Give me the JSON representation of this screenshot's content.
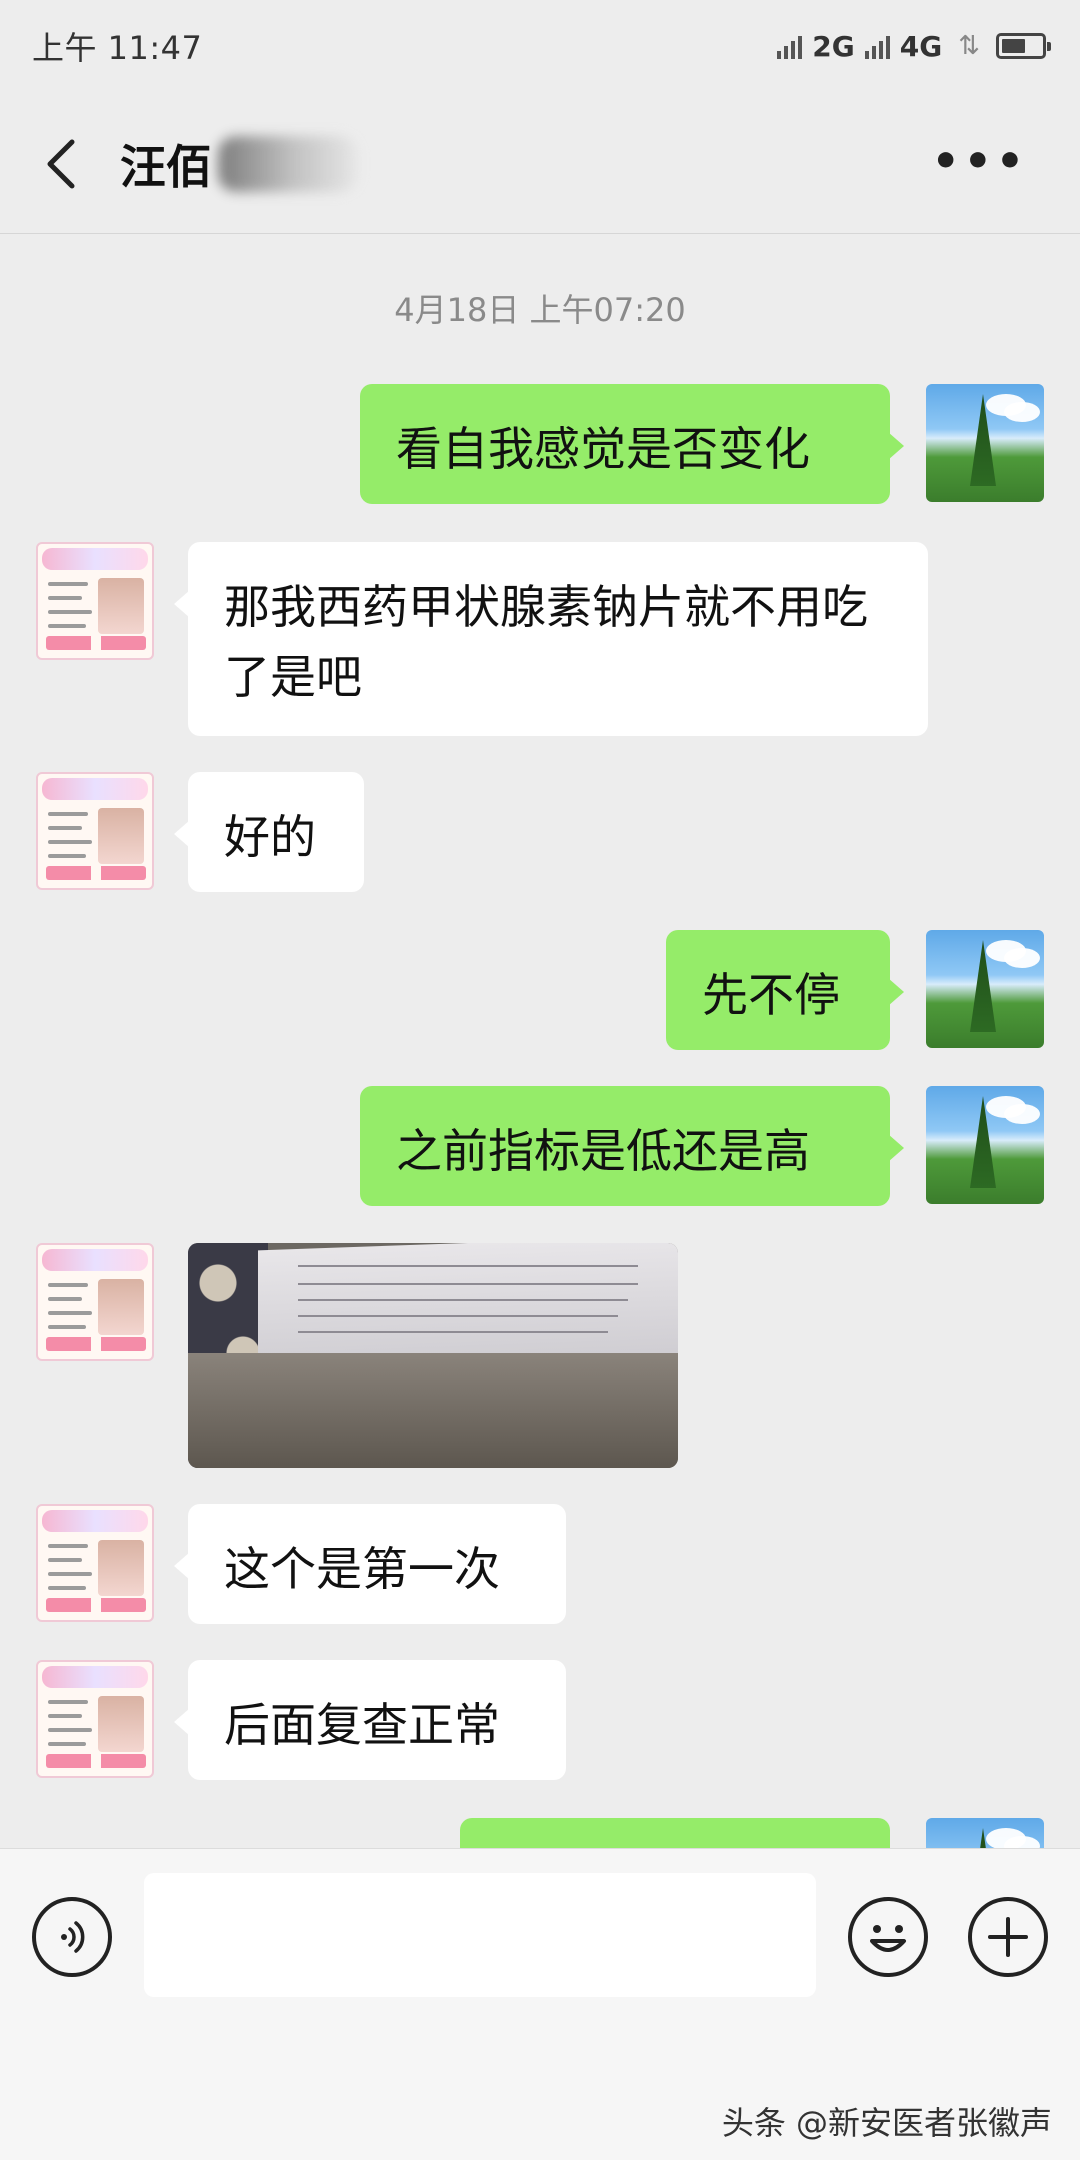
{
  "status_bar": {
    "time": "上午 11:47",
    "network_1": "2G",
    "network_2": "4G"
  },
  "header": {
    "title": "汪佰",
    "back_icon": "back-chevron-icon",
    "more_icon": "more-dots-icon"
  },
  "timestamp": "4月18日 上午07:20",
  "messages": [
    {
      "from": "me",
      "type": "text",
      "text": "看自我感觉是否变化"
    },
    {
      "from": "them",
      "type": "text",
      "text": "那我西药甲状腺素钠片就不用吃了是吧"
    },
    {
      "from": "them",
      "type": "text",
      "text": "好的"
    },
    {
      "from": "me",
      "type": "text",
      "text": "先不停"
    },
    {
      "from": "me",
      "type": "text",
      "text": "之前指标是低还是高"
    },
    {
      "from": "them",
      "type": "image",
      "description_icon": "lab-report-photo"
    },
    {
      "from": "them",
      "type": "text",
      "text": "这个是第一次"
    },
    {
      "from": "them",
      "type": "text",
      "text": "后面复查正常"
    },
    {
      "from": "me",
      "type": "text",
      "text": ""
    }
  ],
  "input_bar": {
    "placeholder": "",
    "voice_icon": "voice-icon",
    "emoji_icon": "emoji-icon",
    "plus_icon": "plus-icon"
  },
  "watermark": "头条 @新安医者张徽声",
  "colors": {
    "background": "#ededed",
    "my_bubble": "#95ec69",
    "their_bubble": "#ffffff"
  }
}
